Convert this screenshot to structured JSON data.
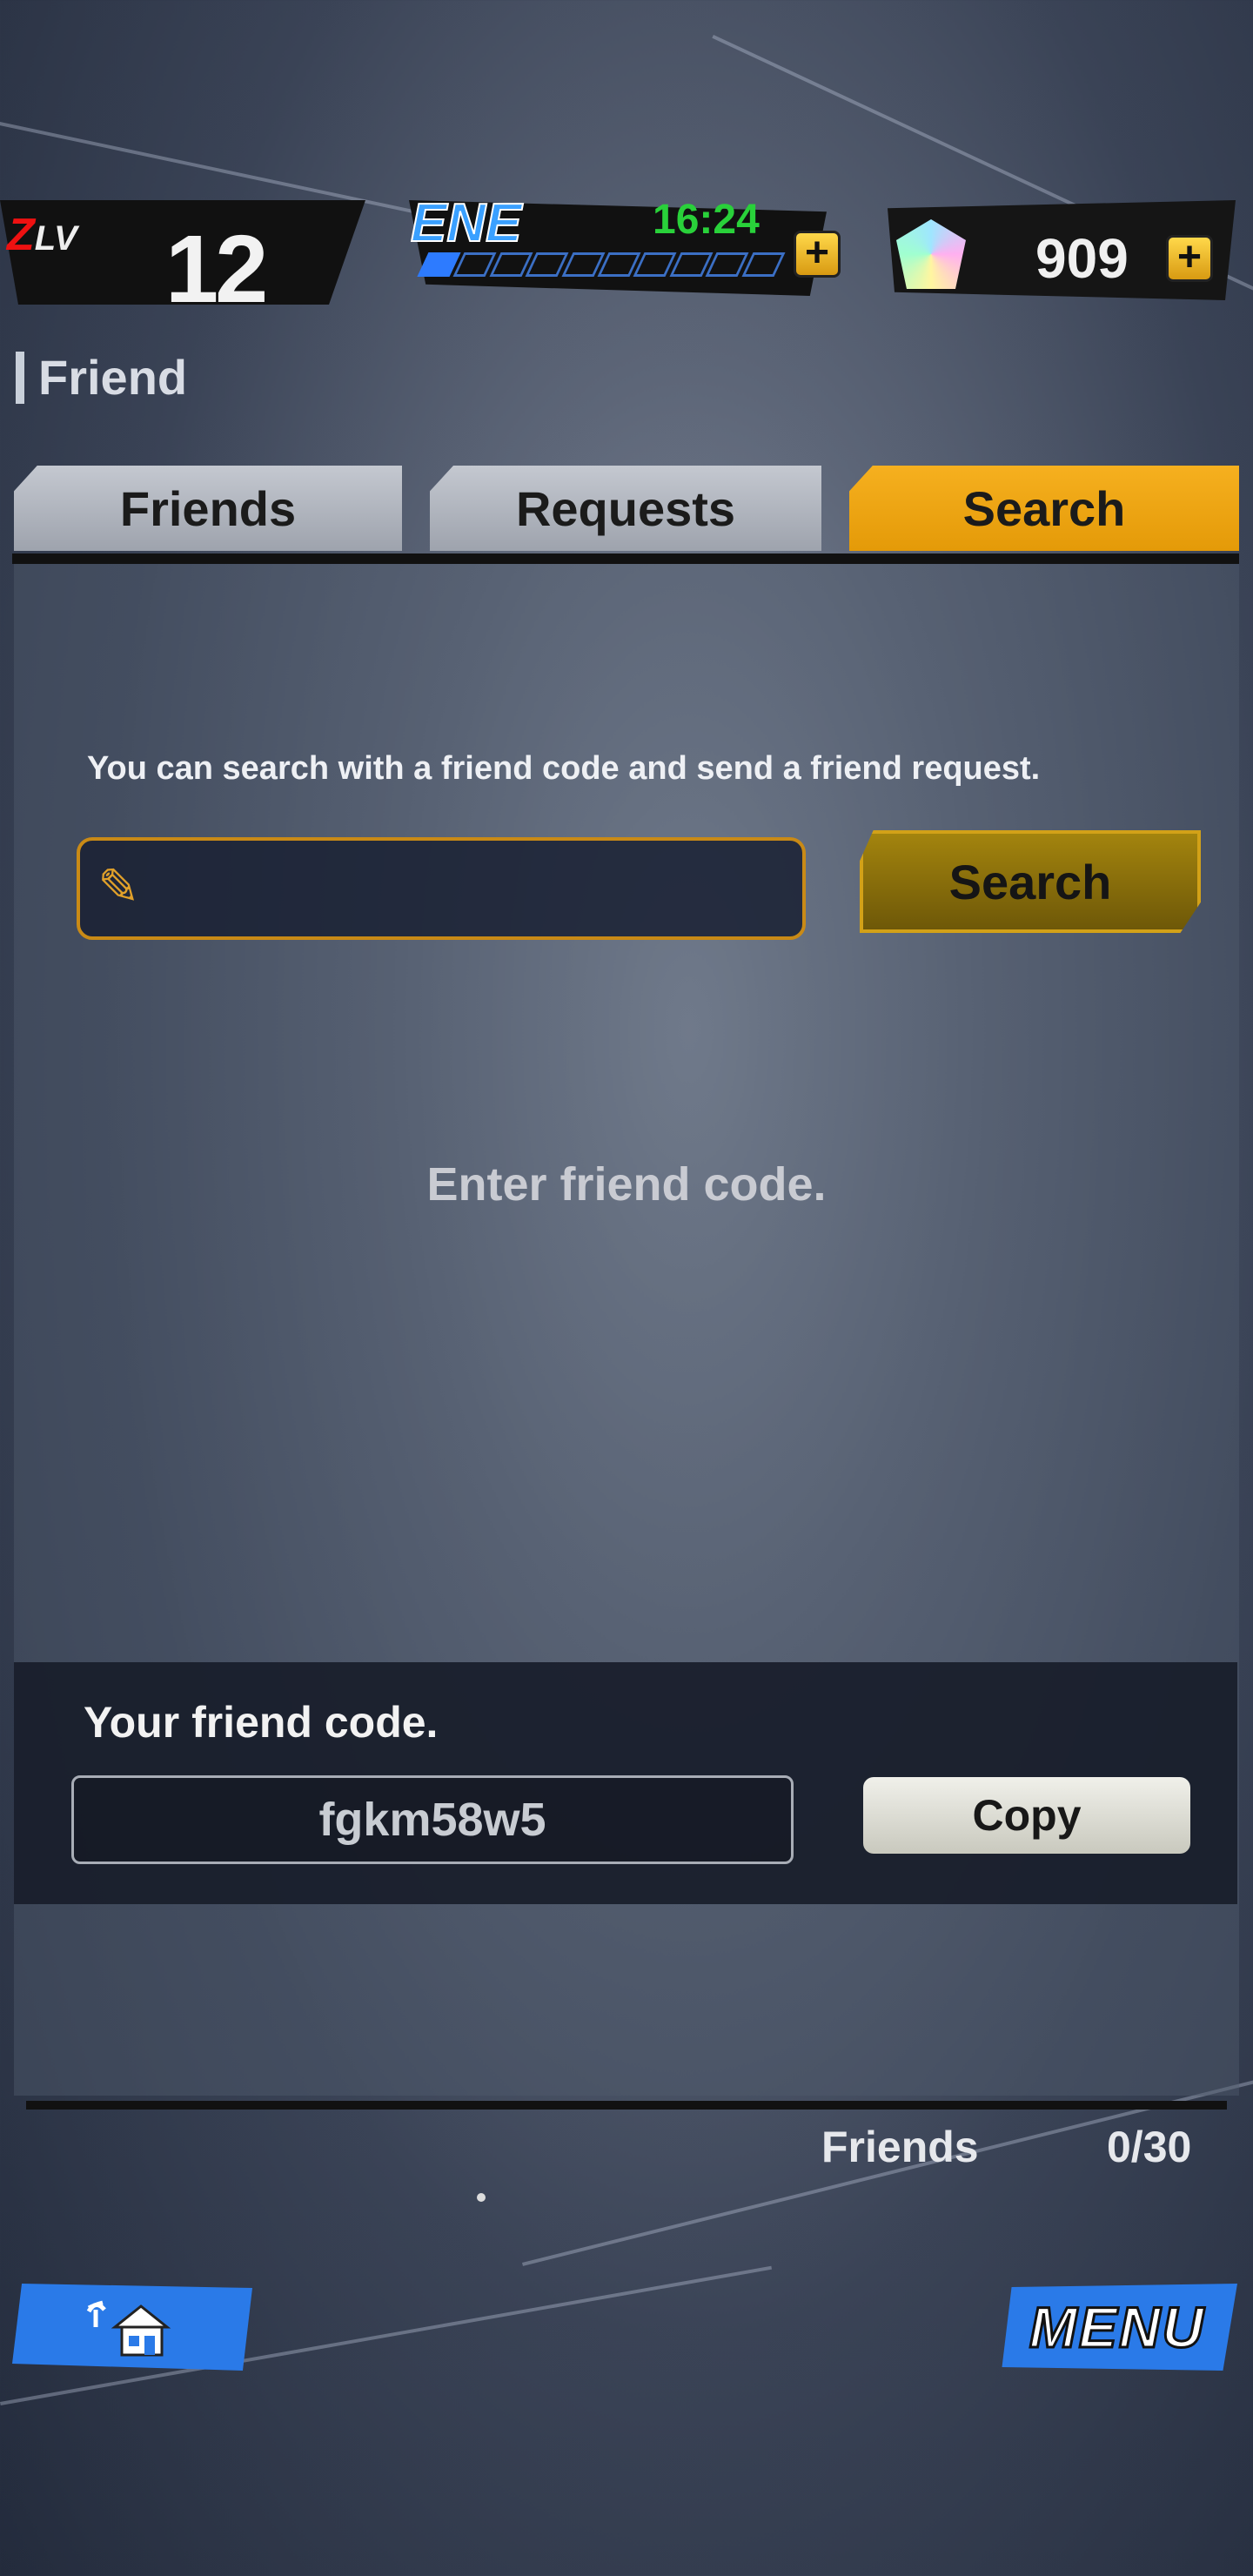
{
  "status": {
    "level_tag_z": "Z",
    "level_tag_lv": "LV",
    "level_value": "12",
    "energy_tag": "ENE",
    "energy_timer": "16:24",
    "energy_fraction": 0.1,
    "energy_plus": "+",
    "gems_count": "909",
    "gems_plus": "+"
  },
  "header": {
    "title": "Friend"
  },
  "tabs": [
    {
      "label": "Friends",
      "active": false
    },
    {
      "label": "Requests",
      "active": false
    },
    {
      "label": "Search",
      "active": true
    }
  ],
  "search": {
    "hint": "You can search with a friend code and send a friend request.",
    "input_value": "",
    "button_label": "Search",
    "empty_message": "Enter friend code."
  },
  "my_code": {
    "label": "Your friend code.",
    "value": "fgkm58w5",
    "copy_label": "Copy"
  },
  "footer": {
    "friends_label": "Friends",
    "friends_count": "0/30",
    "menu_label": "MENU"
  },
  "colors": {
    "tab_active": "#f0a810",
    "tab_inactive": "#b4b8c0",
    "energy_timer": "#29d13a",
    "accent_blue": "#2a7ae8"
  },
  "icons": {
    "pencil": "pencil-icon",
    "home": "home-icon",
    "gem": "gem-icon"
  }
}
